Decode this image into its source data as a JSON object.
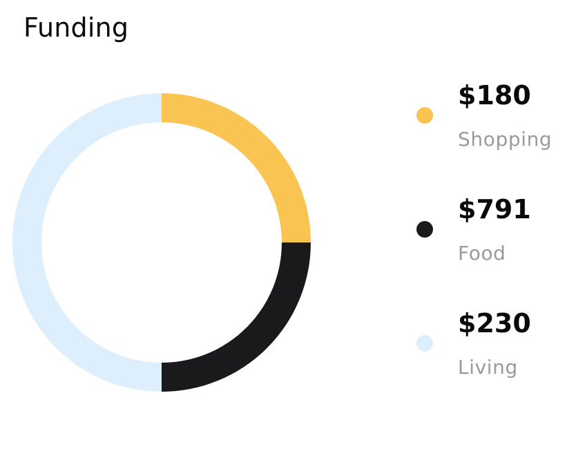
{
  "title": "Funding",
  "chart_data": {
    "type": "pie",
    "variant": "donut",
    "title": "Funding",
    "categories": [
      "Shopping",
      "Food",
      "Living"
    ],
    "values": [
      180,
      791,
      230
    ],
    "value_labels": [
      "$180",
      "$791",
      "$230"
    ],
    "colors": [
      "#F9C452",
      "#1A1A1C",
      "#DDEEFD"
    ],
    "legend": "right",
    "start_angle": "top",
    "direction": "clockwise",
    "slice_fractions": [
      0.25,
      0.25,
      0.5
    ]
  }
}
